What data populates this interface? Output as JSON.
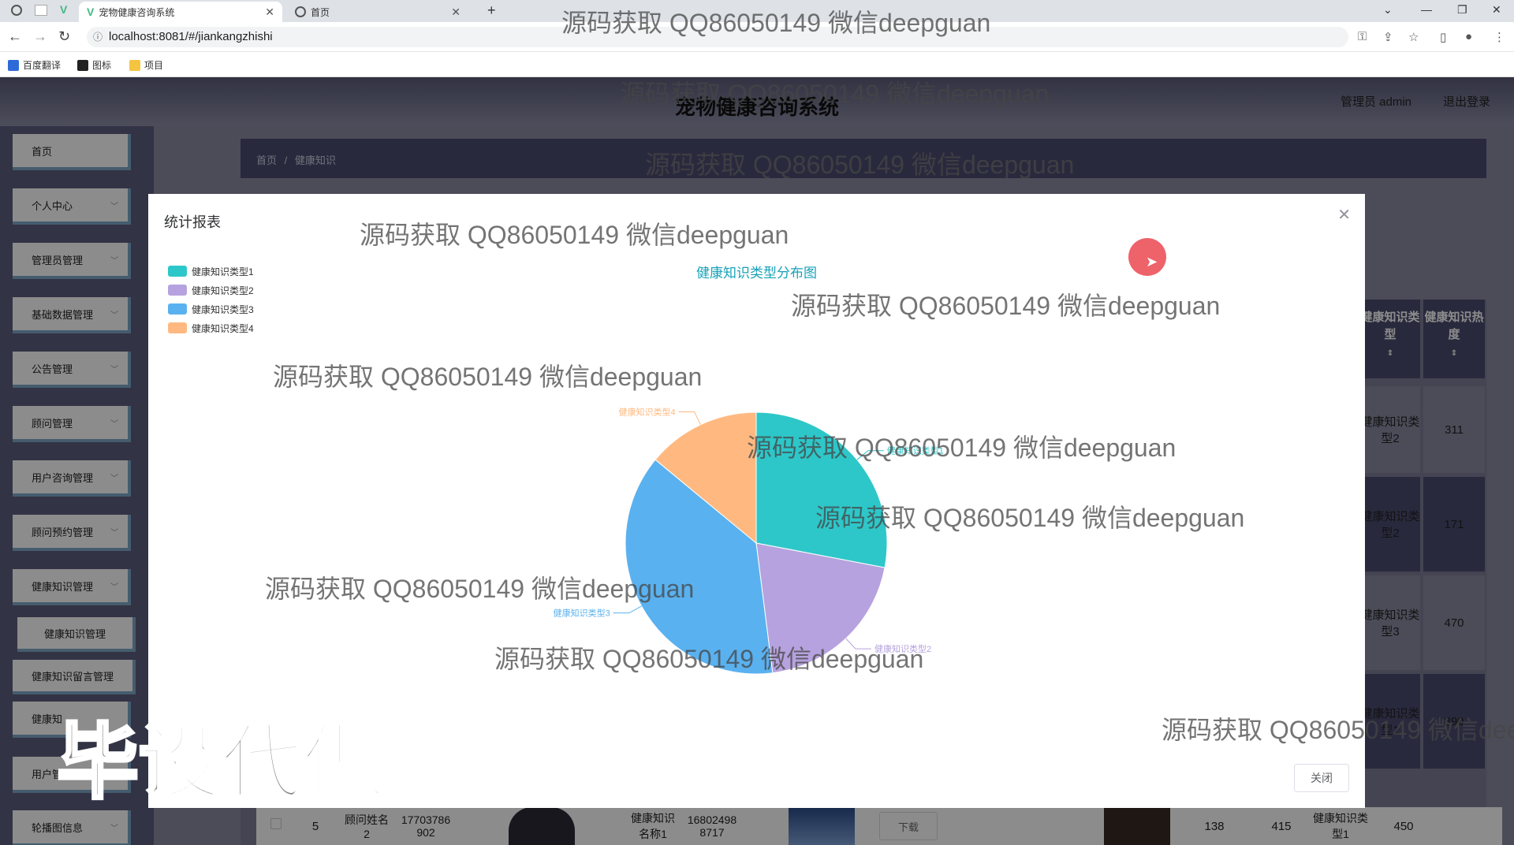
{
  "browser": {
    "tabs": [
      {
        "title": "宠物健康咨询系统",
        "active": true
      },
      {
        "title": "首页",
        "active": false
      }
    ],
    "url": "localhost:8081/#/jiankangzhishi",
    "bookmarks": [
      "百度翻译",
      "图标",
      "项目"
    ]
  },
  "header": {
    "title": "宠物健康咨询系统",
    "admin": "管理员 admin",
    "logout": "退出登录"
  },
  "sidebar": {
    "items": [
      {
        "label": "首页"
      },
      {
        "label": "个人中心"
      },
      {
        "label": "管理员管理"
      },
      {
        "label": "基础数据管理"
      },
      {
        "label": "公告管理"
      },
      {
        "label": "顾问管理"
      },
      {
        "label": "用户咨询管理"
      },
      {
        "label": "顾问预约管理"
      },
      {
        "label": "健康知识管理"
      },
      {
        "label": "健康知识管理"
      },
      {
        "label": "健康知识留言管理"
      },
      {
        "label": "健康知"
      },
      {
        "label": "用户管理"
      },
      {
        "label": "轮播图信息"
      }
    ]
  },
  "breadcrumb": {
    "home": "首页",
    "sep": "/",
    "current": "健康知识"
  },
  "table": {
    "headers": [
      "健康知识类型",
      "健康知识热度"
    ],
    "rows": [
      {
        "type": "健康知识类型2",
        "heat": "311"
      },
      {
        "type": "健康知识类型2",
        "heat": "171"
      },
      {
        "type": "健康知识类型3",
        "heat": "470"
      },
      {
        "type": "健康知识类型1",
        "heat": "390"
      }
    ],
    "bottom_row": {
      "index": "5",
      "consultant": "顾问姓名2",
      "phone": "17703786902",
      "name": "健康知识名称1",
      "number": "168024988717",
      "download": "下载",
      "num1": "138",
      "num2": "415",
      "type": "健康知识类型1",
      "heat": "450"
    }
  },
  "modal": {
    "title": "统计报表",
    "close_label": "关闭"
  },
  "chart_data": {
    "type": "pie",
    "title": "健康知识类型分布图",
    "categories": [
      "健康知识类型1",
      "健康知识类型2",
      "健康知识类型3",
      "健康知识类型4"
    ],
    "values": [
      28,
      20,
      38,
      14
    ],
    "colors": [
      "#2ec7c9",
      "#b6a2de",
      "#5ab1ef",
      "#ffb980"
    ],
    "legend_position": "top-left"
  },
  "watermarks": {
    "text": "源码获取 QQ86050149 微信deepguan",
    "big": "毕设代做"
  }
}
